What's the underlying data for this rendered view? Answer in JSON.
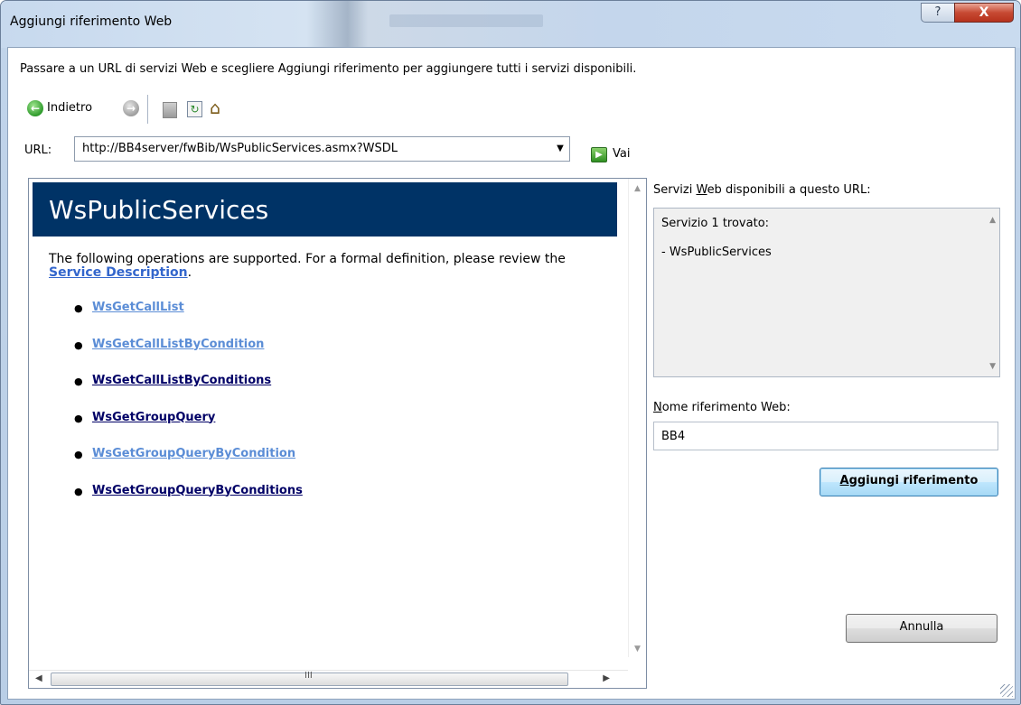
{
  "window": {
    "title": "Aggiungi riferimento Web",
    "help_label": "?",
    "close_label": "X"
  },
  "instructions": "Passare a un URL di servizi Web e scegliere Aggiungi riferimento per aggiungere tutti i servizi disponibili.",
  "toolbar": {
    "back_label": "Indietro",
    "back_icon": "back-arrow-icon",
    "forward_icon": "forward-arrow-icon",
    "stop_icon": "stop-icon",
    "refresh_icon": "refresh-icon",
    "home_icon": "home-icon"
  },
  "url": {
    "label": "URL:",
    "value": "http://BB4server/fwBib/WsPublicServices.asmx?WSDL",
    "go_label": "Vai"
  },
  "browser": {
    "service_title": "WsPublicServices",
    "intro_text": "The following operations are supported. For a formal definition, please review the ",
    "intro_link": "Service Description",
    "intro_end": ".",
    "operations": [
      {
        "name": "WsGetCallList",
        "visited": true
      },
      {
        "name": "WsGetCallListByCondition",
        "visited": true
      },
      {
        "name": "WsGetCallListByConditions",
        "visited": false
      },
      {
        "name": "WsGetGroupQuery",
        "visited": false
      },
      {
        "name": "WsGetGroupQueryByCondition",
        "visited": true
      },
      {
        "name": "WsGetGroupQueryByConditions",
        "visited": false
      }
    ],
    "header_color": "#003366"
  },
  "available": {
    "label_pre": "Servizi ",
    "label_key": "W",
    "label_post": "eb disponibili a questo URL:",
    "line1": "Servizio 1 trovato:",
    "line2": "- WsPublicServices"
  },
  "reference": {
    "label_key": "N",
    "label_post": "ome riferimento Web:",
    "value": "BB4"
  },
  "buttons": {
    "add_key": "A",
    "add_post": "ggiungi riferimento",
    "cancel_label": "Annulla"
  }
}
